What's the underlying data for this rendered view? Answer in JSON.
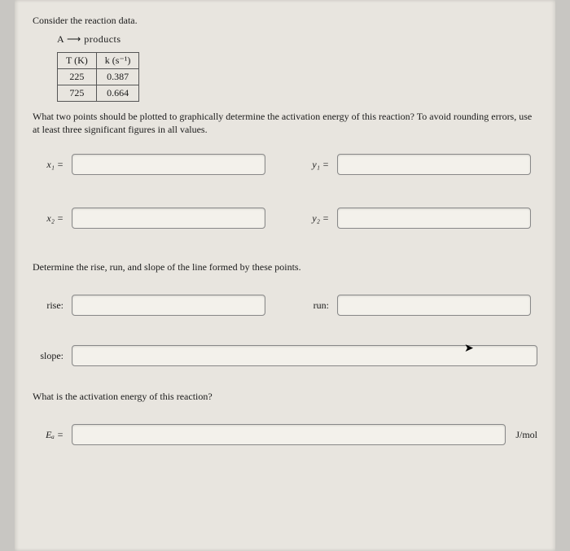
{
  "intro": "Consider the reaction data.",
  "reaction": "A ⟶ products",
  "table": {
    "header_T": "T (K)",
    "header_k": "k (s⁻¹)",
    "rows": [
      {
        "T": "225",
        "k": "0.387"
      },
      {
        "T": "725",
        "k": "0.664"
      }
    ]
  },
  "question1": "What two points should be plotted to graphically determine the activation energy of this reaction? To avoid rounding errors, use at least three significant figures in all values.",
  "labels": {
    "x1": "x₁ =",
    "y1": "y₁ =",
    "x2": "x₂ =",
    "y2": "y₂ =",
    "rise": "rise:",
    "run": "run:",
    "slope": "slope:",
    "Ea": "Eₐ ="
  },
  "determine": "Determine the rise, run, and slope of the line formed by these points.",
  "question2": "What is the activation energy of this reaction?",
  "unit": "J/mol",
  "values": {
    "x1": "",
    "y1": "",
    "x2": "",
    "y2": "",
    "rise": "",
    "run": "",
    "slope": "",
    "Ea": ""
  }
}
